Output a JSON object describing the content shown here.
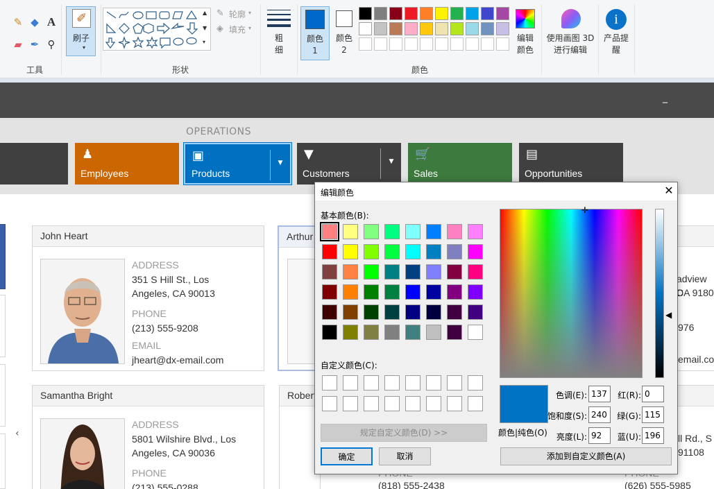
{
  "ribbon": {
    "tools_label": "工具",
    "brush_label": "刷子",
    "shapes_label": "形状",
    "outline_label": "轮廓",
    "fill_label": "填充",
    "size_label": "粗细",
    "color1_label": "颜色 1",
    "color2_label": "颜色 2",
    "colors_label": "颜色",
    "edit_colors_label": "编辑颜色",
    "paint3d_label": "使用画图 3D 进行编辑",
    "product_alert_label": "产品提醒",
    "color1_value": "#0068c8",
    "color2_value": "#ffffff",
    "palette_row1": [
      "#000000",
      "#7f7f7f",
      "#880015",
      "#ed1c24",
      "#ff7f27",
      "#fff200",
      "#22b14c",
      "#00a2e8",
      "#3f48cc",
      "#a349a4"
    ],
    "palette_row2": [
      "#ffffff",
      "#c3c3c3",
      "#b97a57",
      "#ffaec9",
      "#ffc90e",
      "#efe4b0",
      "#b5e61d",
      "#99d9ea",
      "#7092be",
      "#c8bfe7"
    ]
  },
  "app": {
    "section_label": "OPERATIONS",
    "nav": [
      {
        "label": "Employees",
        "color": "#cc6600"
      },
      {
        "label": "Products",
        "color": "#0070c0"
      },
      {
        "label": "Customers",
        "color": "#404040"
      },
      {
        "label": "Sales",
        "color": "#3d7a3d"
      },
      {
        "label": "Opportunities",
        "color": "#404040"
      }
    ],
    "cards": [
      {
        "name": "John Heart",
        "address_label": "ADDRESS",
        "address1": "351 S Hill St., Los",
        "address2": "Angeles, CA 90013",
        "phone_label": "PHONE",
        "phone": "(213) 555-9208",
        "email_label": "EMAIL",
        "email": "jheart@dx-email.com"
      },
      {
        "name": "Samantha Bright",
        "address_label": "ADDRESS",
        "address1": "5801 Wilshire Blvd., Los",
        "address2": "Angeles, CA 90036",
        "phone_label": "PHONE",
        "phone": "(213) 555-0288"
      }
    ],
    "partial_names": [
      "Arthur",
      "Robert"
    ],
    "partial_right": [
      "adview D",
      "CA 9180",
      "976",
      "email.co",
      "ll Rd., S",
      "91108",
      "(626) 555-5985"
    ],
    "partial_phone_mid": "(818) 555-2438",
    "partial_phone_mid_label": "PHONE",
    "partial_phone_right_label": "PHONE",
    "scroll_left_glyph": "‹",
    "minimize_glyph": "_"
  },
  "dialog": {
    "title": "编辑颜色",
    "basic_colors_label": "基本颜色(B):",
    "custom_colors_label": "自定义颜色(C):",
    "define_custom_button": "规定自定义颜色(D) >>",
    "ok_button": "确定",
    "cancel_button": "取消",
    "add_custom_button": "添加到自定义颜色(A)",
    "color_solid_label": "颜色|纯色(O)",
    "hue_label": "色调(E):",
    "hue": "137",
    "sat_label": "饱和度(S):",
    "sat": "240",
    "lum_label": "亮度(L):",
    "lum": "92",
    "red_label": "红(R):",
    "red": "0",
    "green_label": "绿(G):",
    "green": "115",
    "blue_label": "蓝(U):",
    "blue": "196",
    "current_color": "#0073c4",
    "basic_colors": [
      [
        "#ff8080",
        "#ffff80",
        "#80ff80",
        "#00ff80",
        "#80ffff",
        "#0080ff",
        "#ff80c0",
        "#ff80ff"
      ],
      [
        "#ff0000",
        "#ffff00",
        "#80ff00",
        "#00ff40",
        "#00ffff",
        "#0080c0",
        "#8080c0",
        "#ff00ff"
      ],
      [
        "#804040",
        "#ff8040",
        "#00ff00",
        "#008080",
        "#004080",
        "#8080ff",
        "#800040",
        "#ff0080"
      ],
      [
        "#800000",
        "#ff8000",
        "#008000",
        "#008040",
        "#0000ff",
        "#0000a0",
        "#800080",
        "#8000ff"
      ],
      [
        "#400000",
        "#804000",
        "#004000",
        "#004040",
        "#000080",
        "#000040",
        "#400040",
        "#400080"
      ],
      [
        "#000000",
        "#808000",
        "#808040",
        "#808080",
        "#408080",
        "#c0c0c0",
        "#400040",
        "#ffffff"
      ]
    ]
  }
}
